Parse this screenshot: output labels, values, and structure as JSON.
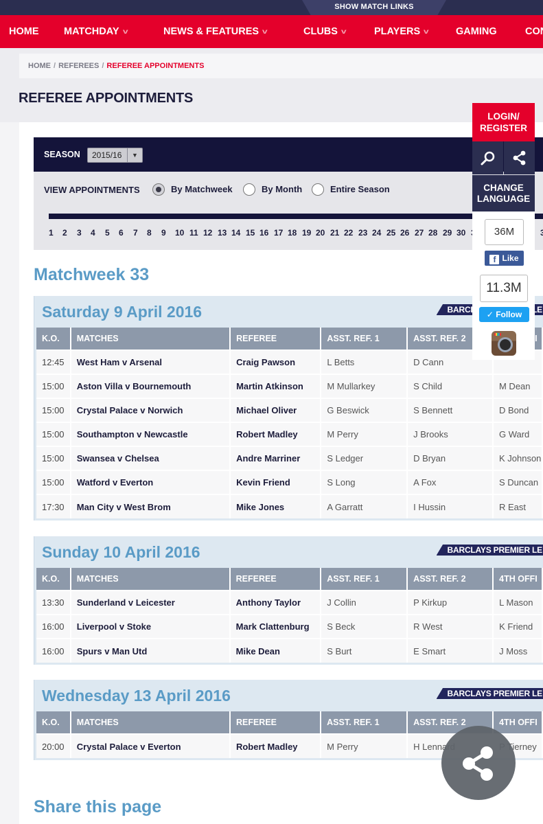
{
  "header": {
    "match_links": "SHOW MATCH LINKS"
  },
  "nav": [
    {
      "label": "HOME",
      "has_menu": false
    },
    {
      "label": "MATCHDAY",
      "has_menu": true
    },
    {
      "label": "NEWS & FEATURES",
      "has_menu": true
    },
    {
      "label": "CLUBS",
      "has_menu": true
    },
    {
      "label": "PLAYERS",
      "has_menu": true
    },
    {
      "label": "GAMING",
      "has_menu": false
    },
    {
      "label": "CON",
      "has_menu": false
    }
  ],
  "breadcrumb": [
    "HOME",
    "REFEREES",
    "REFEREE APPOINTMENTS"
  ],
  "page_title": "REFEREE APPOINTMENTS",
  "season": {
    "label": "SEASON",
    "selected": "2015/16"
  },
  "view": {
    "label": "VIEW APPOINTMENTS",
    "options": [
      "By Matchweek",
      "By Month",
      "Entire Season"
    ],
    "selected": "By Matchweek"
  },
  "weeks": [
    "1",
    "2",
    "3",
    "4",
    "5",
    "6",
    "7",
    "8",
    "9",
    "10",
    "11",
    "12",
    "13",
    "14",
    "15",
    "16",
    "17",
    "18",
    "19",
    "20",
    "21",
    "22",
    "23",
    "24",
    "25",
    "26",
    "27",
    "28",
    "29",
    "30",
    "3",
    "3"
  ],
  "matchweek_title": "Matchweek 33",
  "columns": [
    "K.O.",
    "MATCHES",
    "REFEREE",
    "ASST. REF. 1",
    "ASST. REF. 2",
    "4TH OFFI"
  ],
  "sponsor": "BARCLAYS PREMIER LE",
  "days": [
    {
      "title": "Saturday 9 April 2016",
      "rows": [
        [
          "12:45",
          "West Ham v Arsenal",
          "Craig Pawson",
          "L Betts",
          "D Cann",
          ""
        ],
        [
          "15:00",
          "Aston Villa v Bournemouth",
          "Martin Atkinson",
          "M Mullarkey",
          "S Child",
          "M Dean"
        ],
        [
          "15:00",
          "Crystal Palace v Norwich",
          "Michael Oliver",
          "G Beswick",
          "S Bennett",
          "D Bond"
        ],
        [
          "15:00",
          "Southampton v Newcastle",
          "Robert Madley",
          "M Perry",
          "J Brooks",
          "G Ward"
        ],
        [
          "15:00",
          "Swansea v Chelsea",
          "Andre Marriner",
          "S Ledger",
          "D Bryan",
          "K Johnson"
        ],
        [
          "15:00",
          "Watford v Everton",
          "Kevin Friend",
          "S Long",
          "A Fox",
          "S Duncan"
        ],
        [
          "17:30",
          "Man City v West Brom",
          "Mike Jones",
          "A Garratt",
          "I Hussin",
          "R East"
        ]
      ]
    },
    {
      "title": "Sunday 10 April 2016",
      "rows": [
        [
          "13:30",
          "Sunderland v Leicester",
          "Anthony Taylor",
          "J Collin",
          "P Kirkup",
          "L Mason"
        ],
        [
          "16:00",
          "Liverpool v Stoke",
          "Mark Clattenburg",
          "S Beck",
          "R West",
          "K Friend"
        ],
        [
          "16:00",
          "Spurs v Man Utd",
          "Mike Dean",
          "S Burt",
          "E Smart",
          "J Moss"
        ]
      ]
    },
    {
      "title": "Wednesday 13 April 2016",
      "rows": [
        [
          "20:00",
          "Crystal Palace v Everton",
          "Robert Madley",
          "M Perry",
          "H Lennard",
          "P Tierney"
        ]
      ]
    }
  ],
  "share_title": "Share this page",
  "side": {
    "login": "LOGIN/ REGISTER",
    "language": "CHANGE LANGUAGE",
    "fb_count": "36M",
    "fb_label": "Like",
    "tw_count": "11.3M",
    "tw_label": "Follow"
  },
  "colors": {
    "brand_red": "#e4002b",
    "navy": "#14143a",
    "heading_blue": "#5a9bc6"
  }
}
